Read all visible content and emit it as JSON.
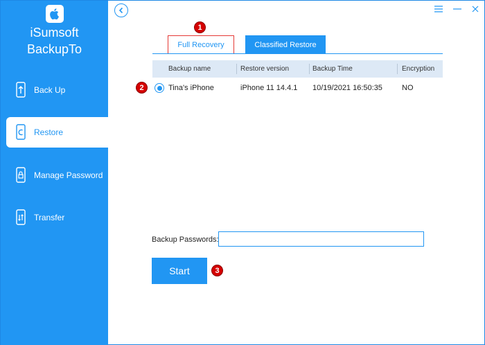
{
  "app": {
    "name_line1": "iSumsoft",
    "name_line2": "BackupTo"
  },
  "sidebar": {
    "items": [
      {
        "label": "Back Up",
        "icon": "phone-upload-icon",
        "active": false
      },
      {
        "label": "Restore",
        "icon": "phone-restore-icon",
        "active": true
      },
      {
        "label": "Manage Password",
        "icon": "phone-lock-icon",
        "active": false
      },
      {
        "label": "Transfer",
        "icon": "phone-transfer-icon",
        "active": false
      }
    ]
  },
  "titlebar": {
    "back_icon": "chevron-left-icon",
    "menu_icon": "menu-icon",
    "minimize_icon": "minimize-icon",
    "close_icon": "close-icon"
  },
  "tabs": {
    "full_recovery": "Full Recovery",
    "classified_restore": "Classified Restore"
  },
  "badges": {
    "one": "1",
    "two": "2",
    "three": "3"
  },
  "table": {
    "headers": [
      "Backup name",
      "Restore version",
      "Backup Time",
      "Encryption"
    ],
    "rows": [
      {
        "name": "Tina's iPhone",
        "version": "iPhone 11 14.4.1",
        "time": "10/19/2021 16:50:35",
        "encryption": "NO",
        "selected": true
      }
    ]
  },
  "password": {
    "label": "Backup Passwords:",
    "value": ""
  },
  "start_label": "Start",
  "colors": {
    "accent": "#2196f3",
    "badge": "#d50000",
    "header_bg": "#dde9f6"
  }
}
